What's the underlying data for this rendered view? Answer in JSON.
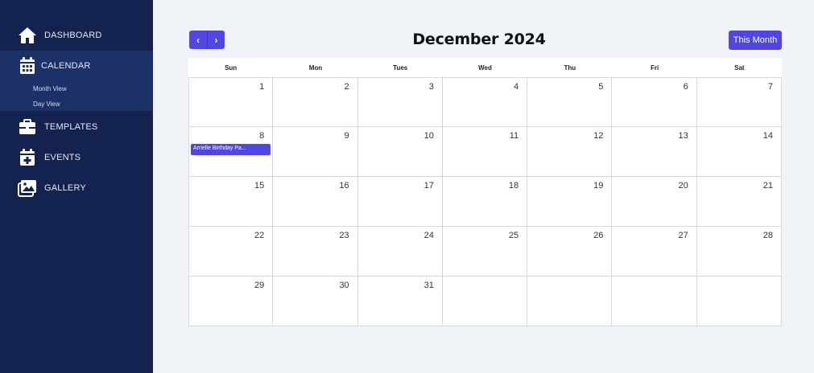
{
  "sidebar": {
    "items": [
      {
        "label": "DASHBOARD",
        "icon": "home-icon"
      },
      {
        "label": "CALENDAR",
        "icon": "calendar-icon"
      },
      {
        "label": "TEMPLATES",
        "icon": "briefcase-icon"
      },
      {
        "label": "EVENTS",
        "icon": "calendar-plus-icon"
      },
      {
        "label": "GALLERY",
        "icon": "gallery-icon"
      }
    ],
    "calendar_sub": [
      "Month View",
      "Day View"
    ]
  },
  "header": {
    "title": "December 2024",
    "prev_glyph": "‹",
    "next_glyph": "›",
    "this_month_label": "This Month"
  },
  "calendar": {
    "weekdays": [
      "Sun",
      "Mon",
      "Tues",
      "Wed",
      "Thu",
      "Fri",
      "Sat"
    ],
    "weeks": [
      [
        "1",
        "2",
        "3",
        "4",
        "5",
        "6",
        "7"
      ],
      [
        "8",
        "9",
        "10",
        "11",
        "12",
        "13",
        "14"
      ],
      [
        "15",
        "16",
        "17",
        "18",
        "19",
        "20",
        "21"
      ],
      [
        "22",
        "23",
        "24",
        "25",
        "26",
        "27",
        "28"
      ],
      [
        "29",
        "30",
        "31",
        "",
        "",
        "",
        ""
      ]
    ],
    "events": [
      {
        "day": "8",
        "title": "Arrielle Birthday Pa..."
      }
    ]
  },
  "colors": {
    "sidebar_bg": "#13224f",
    "sidebar_active_bg": "#1b3168",
    "accent": "#4f46e5",
    "page_bg": "#f0f3f8"
  }
}
